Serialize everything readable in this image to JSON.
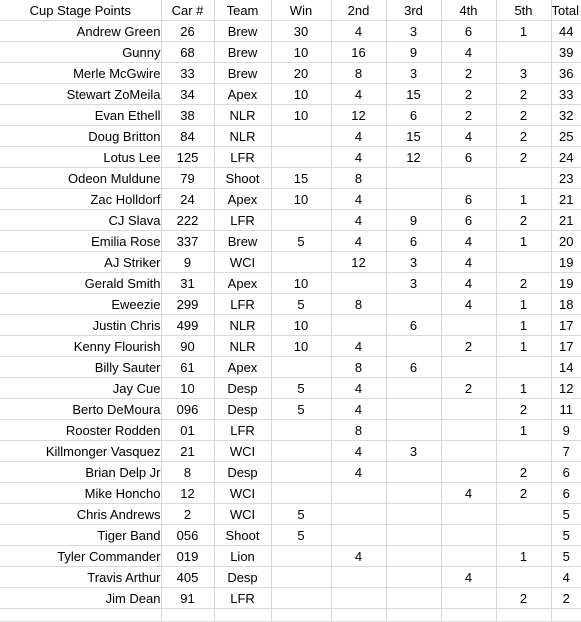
{
  "table": {
    "headers": {
      "name": "Cup Stage Points",
      "car": "Car #",
      "team": "Team",
      "win": "Win",
      "second": "2nd",
      "third": "3rd",
      "fourth": "4th",
      "fifth": "5th",
      "total": "Total Pts"
    },
    "rows": [
      {
        "name": "Andrew Green",
        "car": "26",
        "team": "Brew",
        "team_bold": true,
        "win": "30",
        "second": "4",
        "third": "3",
        "fourth": "6",
        "fifth": "1",
        "total": "44"
      },
      {
        "name": "Gunny",
        "car": "68",
        "team": "Brew",
        "team_bold": true,
        "win": "10",
        "second": "16",
        "third": "9",
        "fourth": "4",
        "fifth": "",
        "total": "39"
      },
      {
        "name": "Merle McGwire",
        "car": "33",
        "team": "Brew",
        "team_bold": true,
        "win": "20",
        "second": "8",
        "third": "3",
        "fourth": "2",
        "fifth": "3",
        "total": "36"
      },
      {
        "name": "Stewart ZoMeila",
        "car": "34",
        "team": "Apex",
        "team_bold": true,
        "win": "10",
        "second": "4",
        "third": "15",
        "fourth": "2",
        "fifth": "2",
        "total": "33"
      },
      {
        "name": "Evan Ethell",
        "car": "38",
        "team": "NLR",
        "team_bold": true,
        "win": "10",
        "second": "12",
        "third": "6",
        "fourth": "2",
        "fifth": "2",
        "total": "32"
      },
      {
        "name": "Doug Britton",
        "car": "84",
        "team": "NLR",
        "team_bold": true,
        "win": "",
        "second": "4",
        "third": "15",
        "fourth": "4",
        "fifth": "2",
        "total": "25"
      },
      {
        "name": "Lotus Lee",
        "car": "125",
        "team": "LFR",
        "team_bold": true,
        "win": "",
        "second": "4",
        "third": "12",
        "fourth": "6",
        "fifth": "2",
        "total": "24"
      },
      {
        "name": "Odeon Muldune",
        "car": "79",
        "team": "Shoot",
        "team_bold": true,
        "win": "15",
        "second": "8",
        "third": "",
        "fourth": "",
        "fifth": "",
        "total": "23"
      },
      {
        "name": "Zac Holldorf",
        "car": "24",
        "team": "Apex",
        "team_bold": true,
        "win": "10",
        "second": "4",
        "third": "",
        "fourth": "6",
        "fifth": "1",
        "total": "21"
      },
      {
        "name": "CJ Slava",
        "car": "222",
        "team": "LFR",
        "team_bold": true,
        "win": "",
        "second": "4",
        "third": "9",
        "fourth": "6",
        "fifth": "2",
        "total": "21"
      },
      {
        "name": "Emilia Rose",
        "car": "337",
        "team": "Brew",
        "team_bold": true,
        "win": "5",
        "second": "4",
        "third": "6",
        "fourth": "4",
        "fifth": "1",
        "total": "20"
      },
      {
        "name": "AJ Striker",
        "car": "9",
        "team": "WCI",
        "team_bold": true,
        "win": "",
        "second": "12",
        "third": "3",
        "fourth": "4",
        "fifth": "",
        "total": "19"
      },
      {
        "name": "Gerald Smith",
        "car": "31",
        "team": "Apex",
        "team_bold": true,
        "win": "10",
        "second": "",
        "third": "3",
        "fourth": "4",
        "fifth": "2",
        "total": "19"
      },
      {
        "name": "Eweezie",
        "car": "299",
        "team": "LFR",
        "team_bold": true,
        "win": "5",
        "second": "8",
        "third": "",
        "fourth": "4",
        "fifth": "1",
        "total": "18"
      },
      {
        "name": "Justin Chris",
        "car": "499",
        "team": "NLR",
        "team_bold": true,
        "win": "10",
        "second": "",
        "third": "6",
        "fourth": "",
        "fifth": "1",
        "total": "17"
      },
      {
        "name": "Kenny Flourish",
        "car": "90",
        "team": "NLR",
        "team_bold": true,
        "win": "10",
        "second": "4",
        "third": "",
        "fourth": "2",
        "fifth": "1",
        "total": "17"
      },
      {
        "name": "Billy Sauter",
        "car": "61",
        "team": "Apex",
        "team_bold": true,
        "win": "",
        "second": "8",
        "third": "6",
        "fourth": "",
        "fifth": "",
        "total": "14"
      },
      {
        "name": "Jay Cue",
        "car": "10",
        "team": "Desp",
        "team_bold": true,
        "win": "5",
        "second": "4",
        "third": "",
        "fourth": "2",
        "fifth": "1",
        "total": "12"
      },
      {
        "name": "Berto DeMoura",
        "car": "096",
        "team": "Desp",
        "team_bold": true,
        "win": "5",
        "second": "4",
        "third": "",
        "fourth": "",
        "fifth": "2",
        "total": "11"
      },
      {
        "name": "Rooster Rodden",
        "car": "01",
        "team": "LFR",
        "team_bold": false,
        "win": "",
        "second": "8",
        "third": "",
        "fourth": "",
        "fifth": "1",
        "total": "9"
      },
      {
        "name": "Killmonger Vasquez",
        "car": "21",
        "team": "WCI",
        "team_bold": true,
        "win": "",
        "second": "4",
        "third": "3",
        "fourth": "",
        "fifth": "",
        "total": "7"
      },
      {
        "name": "Brian Delp Jr",
        "car": "8",
        "team": "Desp",
        "team_bold": true,
        "win": "",
        "second": "4",
        "third": "",
        "fourth": "",
        "fifth": "2",
        "total": "6"
      },
      {
        "name": "Mike Honcho",
        "car": "12",
        "team": "WCI",
        "team_bold": true,
        "win": "",
        "second": "",
        "third": "",
        "fourth": "4",
        "fifth": "2",
        "total": "6"
      },
      {
        "name": "Chris Andrews",
        "car": "2",
        "team": "WCI",
        "team_bold": true,
        "win": "5",
        "second": "",
        "third": "",
        "fourth": "",
        "fifth": "",
        "total": "5"
      },
      {
        "name": "Tiger Band",
        "car": "056",
        "team": "Shoot",
        "team_bold": true,
        "win": "5",
        "second": "",
        "third": "",
        "fourth": "",
        "fifth": "",
        "total": "5"
      },
      {
        "name": "Tyler Commander",
        "car": "019",
        "team": "Lion",
        "team_bold": true,
        "win": "",
        "second": "4",
        "third": "",
        "fourth": "",
        "fifth": "1",
        "total": "5"
      },
      {
        "name": "Travis Arthur",
        "car": "405",
        "team": "Desp",
        "team_bold": true,
        "win": "",
        "second": "",
        "third": "",
        "fourth": "4",
        "fifth": "",
        "total": "4"
      },
      {
        "name": "Jim Dean",
        "car": "91",
        "team": "LFR",
        "team_bold": false,
        "win": "",
        "second": "",
        "third": "",
        "fourth": "",
        "fifth": "2",
        "total": "2"
      }
    ]
  }
}
